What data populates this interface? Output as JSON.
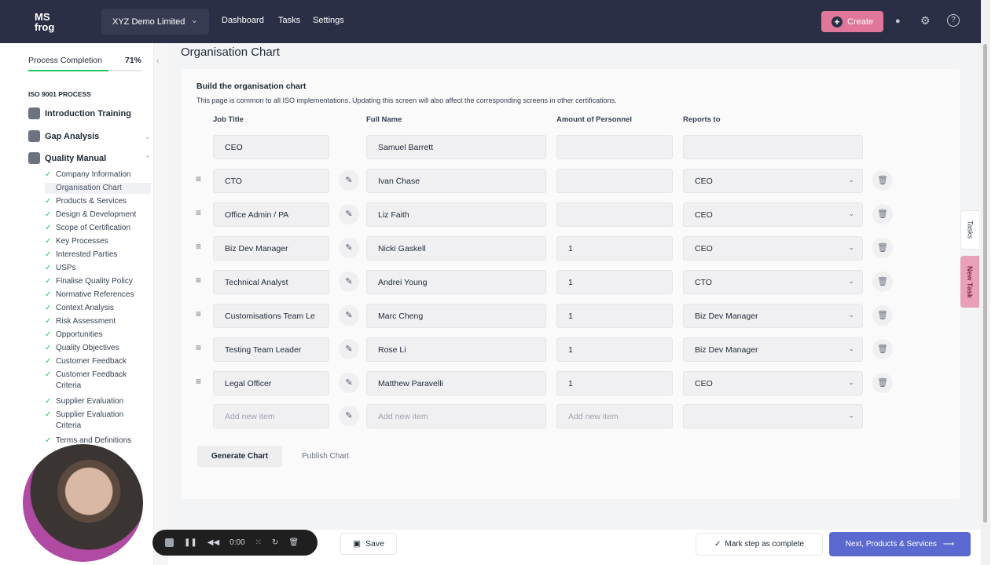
{
  "topbar": {
    "logo_line1": "MS",
    "logo_line2": "frog",
    "company": "XYZ Demo Limited",
    "nav": [
      "Dashboard",
      "Tasks",
      "Settings"
    ],
    "create_label": "Create"
  },
  "sidebar": {
    "progress_label": "Process Completion",
    "progress_value": "71%",
    "progress_fraction": 0.71,
    "heading": "ISO 9001 PROCESS",
    "sections": [
      {
        "label": "Introduction Training"
      },
      {
        "label": "Gap Analysis"
      },
      {
        "label": "Quality Manual"
      }
    ],
    "items": [
      {
        "label": "Company Information",
        "done": true
      },
      {
        "label": "Organisation Chart",
        "done": false,
        "active": true
      },
      {
        "label": "Products & Services",
        "done": true
      },
      {
        "label": "Design & Development",
        "done": true
      },
      {
        "label": "Scope of Certification",
        "done": true
      },
      {
        "label": "Key Processes",
        "done": true
      },
      {
        "label": "Interested Parties",
        "done": true
      },
      {
        "label": "USPs",
        "done": true
      },
      {
        "label": "Finalise Quality Policy",
        "done": true
      },
      {
        "label": "Normative References",
        "done": true
      },
      {
        "label": "Context Analysis",
        "done": true
      },
      {
        "label": "Risk Assessment",
        "done": true
      },
      {
        "label": "Opportunities",
        "done": true
      },
      {
        "label": "Quality Objectives",
        "done": true
      },
      {
        "label": "Customer Feedback",
        "done": true
      },
      {
        "label": "Customer Feedback Criteria",
        "done": true
      },
      {
        "label": "Supplier Evaluation",
        "done": true
      },
      {
        "label": "Supplier Evaluation Criteria",
        "done": true
      },
      {
        "label": "Terms and Definitions",
        "done": true
      }
    ]
  },
  "page": {
    "title": "Organisation Chart",
    "card_title": "Build the organisation chart",
    "card_desc": "This page is common to all ISO implementations. Updating this screen will also affect the corresponding screens in other certifications.",
    "columns": [
      "Job Title",
      "Full Name",
      "Amount of Personnel",
      "Reports to"
    ],
    "root": {
      "job": "CEO",
      "name": "Samuel Barrett"
    },
    "rows": [
      {
        "job": "CTO",
        "name": "Ivan Chase",
        "amount": "",
        "reports": "CEO"
      },
      {
        "job": "Office Admin / PA",
        "name": "Liz Faith",
        "amount": "",
        "reports": "CEO"
      },
      {
        "job": "Biz Dev Manager",
        "name": "Nicki Gaskell",
        "amount": "1",
        "reports": "CEO"
      },
      {
        "job": "Technical Analyst",
        "name": "Andrei Young",
        "amount": "1",
        "reports": "CTO"
      },
      {
        "job": "Customisations Team Le",
        "name": "Marc Cheng",
        "amount": "1",
        "reports": "Biz Dev Manager"
      },
      {
        "job": "Testing Team Leader",
        "name": "Rose Li",
        "amount": "1",
        "reports": "Biz Dev Manager"
      },
      {
        "job": "Legal Officer",
        "name": "Matthew Paravelli",
        "amount": "1",
        "reports": "CEO"
      }
    ],
    "new_placeholder": "Add new item",
    "generate_label": "Generate Chart",
    "publish_label": "Publish Chart"
  },
  "bottom": {
    "save_label": "Save",
    "mark_label": "Mark step as complete",
    "next_label": "Next, Products & Services"
  },
  "recorder": {
    "time": "0:00"
  },
  "side_tabs": {
    "tasks": "Tasks",
    "new_task": "New Task"
  }
}
